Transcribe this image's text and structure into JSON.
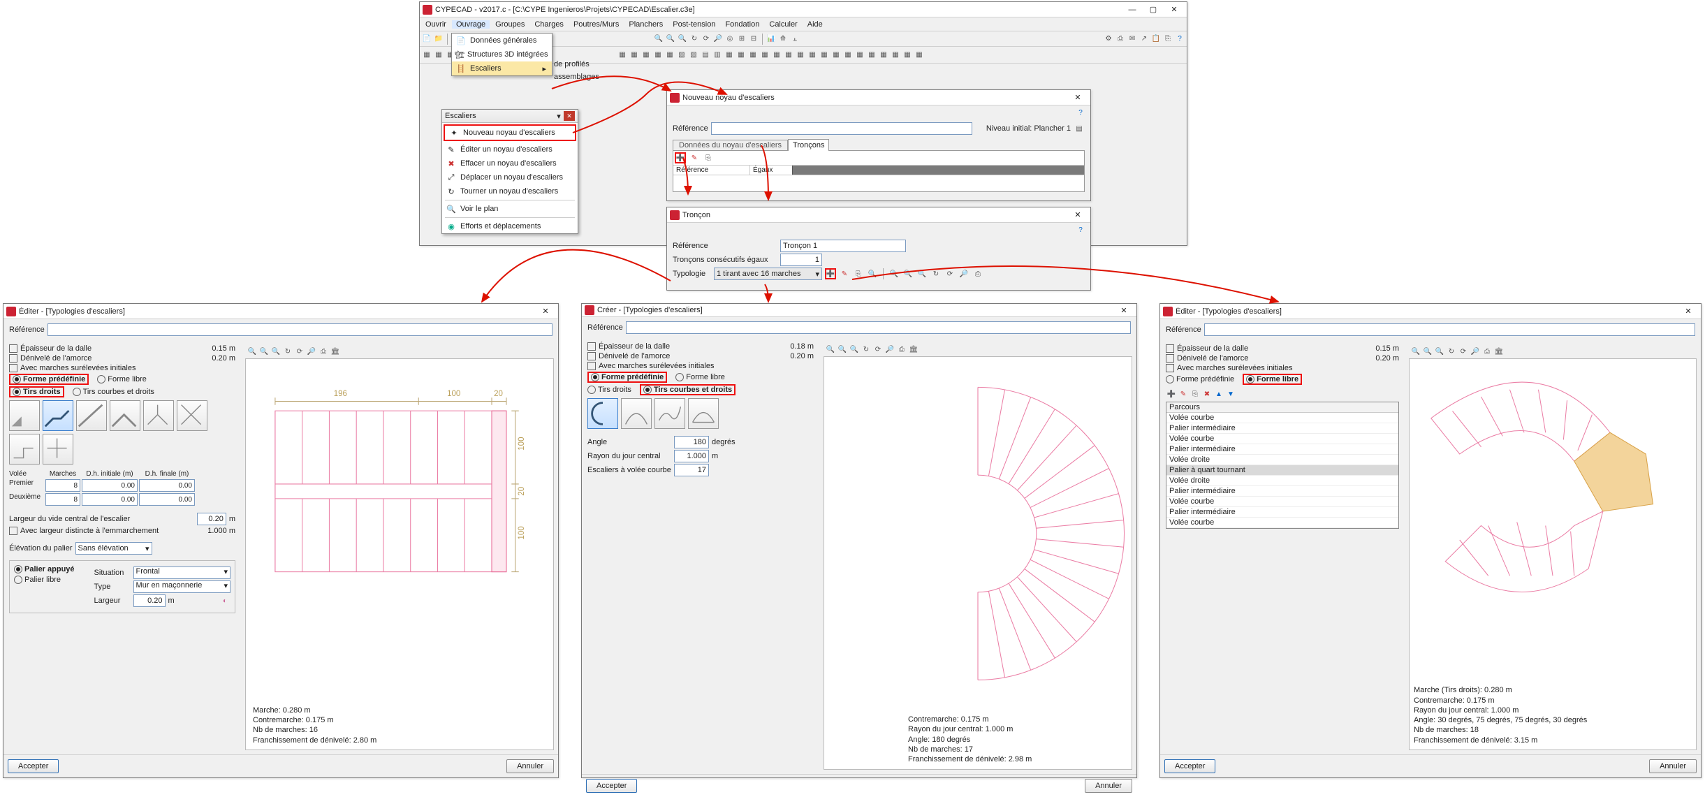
{
  "main_window": {
    "title": "CYPECAD - v2017.c - [C:\\CYPE Ingenieros\\Projets\\CYPECAD\\Escalier.c3e]",
    "menus": [
      "Ouvrir",
      "Ouvrage",
      "Groupes",
      "Charges",
      "Poutres/Murs",
      "Planchers",
      "Post-tension",
      "Fondation",
      "Calculer",
      "Aide"
    ],
    "dropdown": {
      "items": [
        "Données générales",
        "Structures 3D intégrées",
        "Escaliers"
      ],
      "side": [
        "de profilés",
        "assemblages"
      ]
    },
    "escaliers_popup": {
      "title": "Escaliers",
      "items": [
        "Nouveau noyau d'escaliers",
        "Éditer un noyau d'escaliers",
        "Effacer un noyau d'escaliers",
        "Déplacer un noyau d'escaliers",
        "Tourner un noyau d'escaliers",
        "Voir le plan",
        "Efforts et déplacements"
      ]
    },
    "nouveau_dialog": {
      "title": "Nouveau noyau d'escaliers",
      "ref_label": "Référence",
      "niveau": "Niveau initial:  Plancher 1",
      "tabs": [
        "Données du noyau d'escaliers",
        "Tronçons"
      ],
      "cols": [
        "Référence",
        "Égaux"
      ]
    },
    "troncon_dialog": {
      "title": "Tronçon",
      "ref_label": "Référence",
      "ref_value": "Tronçon 1",
      "egaux_label": "Tronçons consécutifs égaux",
      "egaux_value": "1",
      "typ_label": "Typologie",
      "typ_value": "1 tirant avec 16 marches"
    }
  },
  "editer1": {
    "title": "Éditer - [Typologies d'escaliers]",
    "ref_label": "Référence",
    "ep_dalle": "Épaisseur de la dalle",
    "ep_dalle_val": "0.15",
    "ep_unit": "m",
    "deniv": "Dénivelé de l'amorce",
    "deniv_val": "0.20",
    "marches_sur": "Avec marches surélevées initiales",
    "forme_pre": "Forme prédéfinie",
    "forme_libre": "Forme libre",
    "tirs_droits": "Tirs droits",
    "tirs_courb": "Tirs courbes et droits",
    "tbl_hdr": [
      "Volée",
      "Marches",
      "D.h. initiale (m)",
      "D.h. finale (m)"
    ],
    "rows": [
      [
        "Premier",
        "8",
        "0.00",
        "0.00"
      ],
      [
        "Deuxième",
        "8",
        "0.00",
        "0.00"
      ]
    ],
    "largeur_vide": "Largeur du vide central de l'escalier",
    "largeur_vide_val": "0.20",
    "largeur_vide_unit": "m",
    "larg_distincte": "Avec largeur distincte à l'emmarchement",
    "larg_distincte_val": "1.000",
    "larg_distincte_unit": "m",
    "elev": "Élévation du palier",
    "elev_val": "Sans élévation",
    "palier_appuye": "Palier appuyé",
    "palier_libre": "Palier libre",
    "situation": "Situation",
    "situation_val": "Frontal",
    "type": "Type",
    "type_val": "Mur en maçonnerie",
    "largeur": "Largeur",
    "largeur_val": "0.20",
    "largeur_unit": "m",
    "accepter": "Accepter",
    "annuler": "Annuler",
    "dim_top_a": "196",
    "dim_top_b": "100",
    "dim_top_c": "20",
    "dim_r1": "100",
    "dim_r2": "20",
    "dim_r3": "100",
    "annot": [
      "Marche: 0.280 m",
      "Contremarche: 0.175 m",
      "Nb de marches: 16",
      "Franchissement de dénivelé: 2.80 m"
    ]
  },
  "creer": {
    "title": "Créer - [Typologies d'escaliers]",
    "ep_dalle_val": "0.18",
    "deniv_val": "0.20",
    "angle": "Angle",
    "angle_val": "180",
    "angle_unit": "degrés",
    "rayon": "Rayon du jour central",
    "rayon_val": "1.000",
    "rayon_unit": "m",
    "esc_volee": "Escaliers à volée courbe",
    "esc_volee_val": "17",
    "annot": [
      "Contremarche: 0.175 m",
      "Rayon du jour central: 1.000 m",
      "Angle: 180 degrés",
      "Nb de marches: 17",
      "Franchissement de dénivelé: 2.98 m"
    ]
  },
  "editer2": {
    "title": "Éditer - [Typologies d'escaliers]",
    "ep_dalle_val": "0.15",
    "deniv_val": "0.20",
    "parcours_hdr": "Parcours",
    "parcours": [
      "Volée courbe",
      "Palier intermédiaire",
      "Volée courbe",
      "Palier intermédiaire",
      "Volée droite",
      "Palier à quart tournant",
      "Volée droite",
      "Palier intermédiaire",
      "Volée courbe",
      "Palier intermédiaire",
      "Volée courbe"
    ],
    "parcours_sel": 5,
    "annot": [
      "Marche (Tirs droits): 0.280 m",
      "Contremarche: 0.175 m",
      "Rayon du jour central: 1.000 m",
      "Angle: 30 degrés, 75 degrés, 75 degrés, 30 degrés",
      "Nb de marches: 18",
      "Franchissement de dénivelé: 3.15 m"
    ]
  }
}
